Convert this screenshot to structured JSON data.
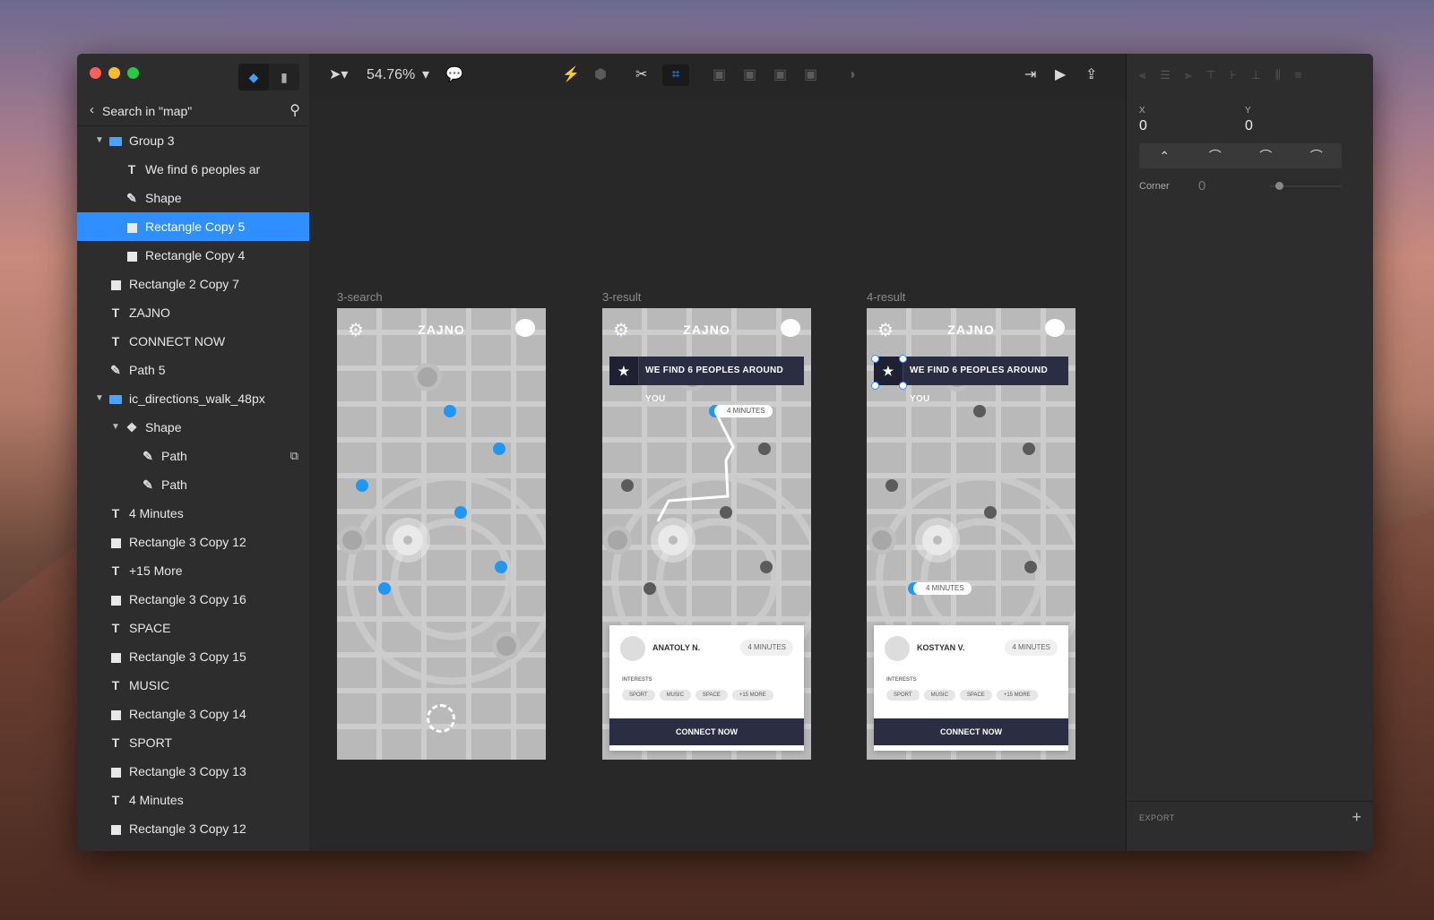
{
  "window": {
    "traffic_lights": [
      "#fe5f57",
      "#febc2e",
      "#28c840"
    ]
  },
  "sidebar": {
    "search_label": "Search in \"map\"",
    "layers": [
      {
        "label": "Group 3",
        "type": "group",
        "indent": 1,
        "expanded": true
      },
      {
        "label": "We find 6 peoples ar",
        "type": "text",
        "indent": 2
      },
      {
        "label": "Shape",
        "type": "path",
        "indent": 2
      },
      {
        "label": "Rectangle Copy 5",
        "type": "rect",
        "indent": 2,
        "selected": true
      },
      {
        "label": "Rectangle Copy 4",
        "type": "rect",
        "indent": 2
      },
      {
        "label": "Rectangle 2 Copy 7",
        "type": "rect",
        "indent": 1
      },
      {
        "label": "ZAJNO",
        "type": "text",
        "indent": 1
      },
      {
        "label": "CONNECT NOW",
        "type": "text",
        "indent": 1
      },
      {
        "label": "Path 5",
        "type": "path",
        "indent": 1
      },
      {
        "label": "ic_directions_walk_48px",
        "type": "group",
        "indent": 1,
        "expanded": true
      },
      {
        "label": "Shape",
        "type": "shape",
        "indent": 2,
        "expanded": true
      },
      {
        "label": "Path",
        "type": "path",
        "indent": 3,
        "badge": true
      },
      {
        "label": "Path",
        "type": "path",
        "indent": 3
      },
      {
        "label": "4 Minutes",
        "type": "text",
        "indent": 1
      },
      {
        "label": "Rectangle 3 Copy 12",
        "type": "rect",
        "indent": 1
      },
      {
        "label": "+15 More",
        "type": "text",
        "indent": 1
      },
      {
        "label": "Rectangle 3 Copy 16",
        "type": "rect",
        "indent": 1
      },
      {
        "label": "SPACE",
        "type": "text",
        "indent": 1
      },
      {
        "label": "Rectangle 3 Copy 15",
        "type": "rect",
        "indent": 1
      },
      {
        "label": "MUSIC",
        "type": "text",
        "indent": 1
      },
      {
        "label": "Rectangle 3 Copy 14",
        "type": "rect",
        "indent": 1
      },
      {
        "label": "SPORT",
        "type": "text",
        "indent": 1
      },
      {
        "label": "Rectangle 3 Copy 13",
        "type": "rect",
        "indent": 1
      },
      {
        "label": "4 Minutes",
        "type": "text",
        "indent": 1
      },
      {
        "label": "Rectangle 3 Copy 12",
        "type": "rect",
        "indent": 1
      }
    ]
  },
  "toolbar": {
    "zoom": "54.76%"
  },
  "artboards": [
    {
      "name": "3-search",
      "brand": "ZAJNO"
    },
    {
      "name": "3-result",
      "brand": "ZAJNO",
      "banner": "WE FIND 6 PEOPLES AROUND YOU",
      "pill": "4 MINUTES",
      "card": {
        "name": "ANATOLY N.",
        "minutes": "4 MINUTES",
        "interests_label": "INTERESTS",
        "tags": [
          "SPORT",
          "MUSIC",
          "SPACE",
          "+15 MORE"
        ],
        "button": "CONNECT NOW"
      }
    },
    {
      "name": "4-result",
      "brand": "ZAJNO",
      "banner": "WE FIND 6 PEOPLES AROUND YOU",
      "pill": "4 MINUTES",
      "card": {
        "name": "KOSTYAN V.",
        "minutes": "4 MINUTES",
        "interests_label": "INTERESTS",
        "tags": [
          "SPORT",
          "MUSIC",
          "SPACE",
          "+15 MORE"
        ],
        "button": "CONNECT NOW"
      }
    }
  ],
  "inspector": {
    "x_label": "X",
    "x_value": "0",
    "y_label": "Y",
    "y_value": "0",
    "corner_label": "Corner",
    "corner_value": "0",
    "export_label": "EXPORT"
  }
}
